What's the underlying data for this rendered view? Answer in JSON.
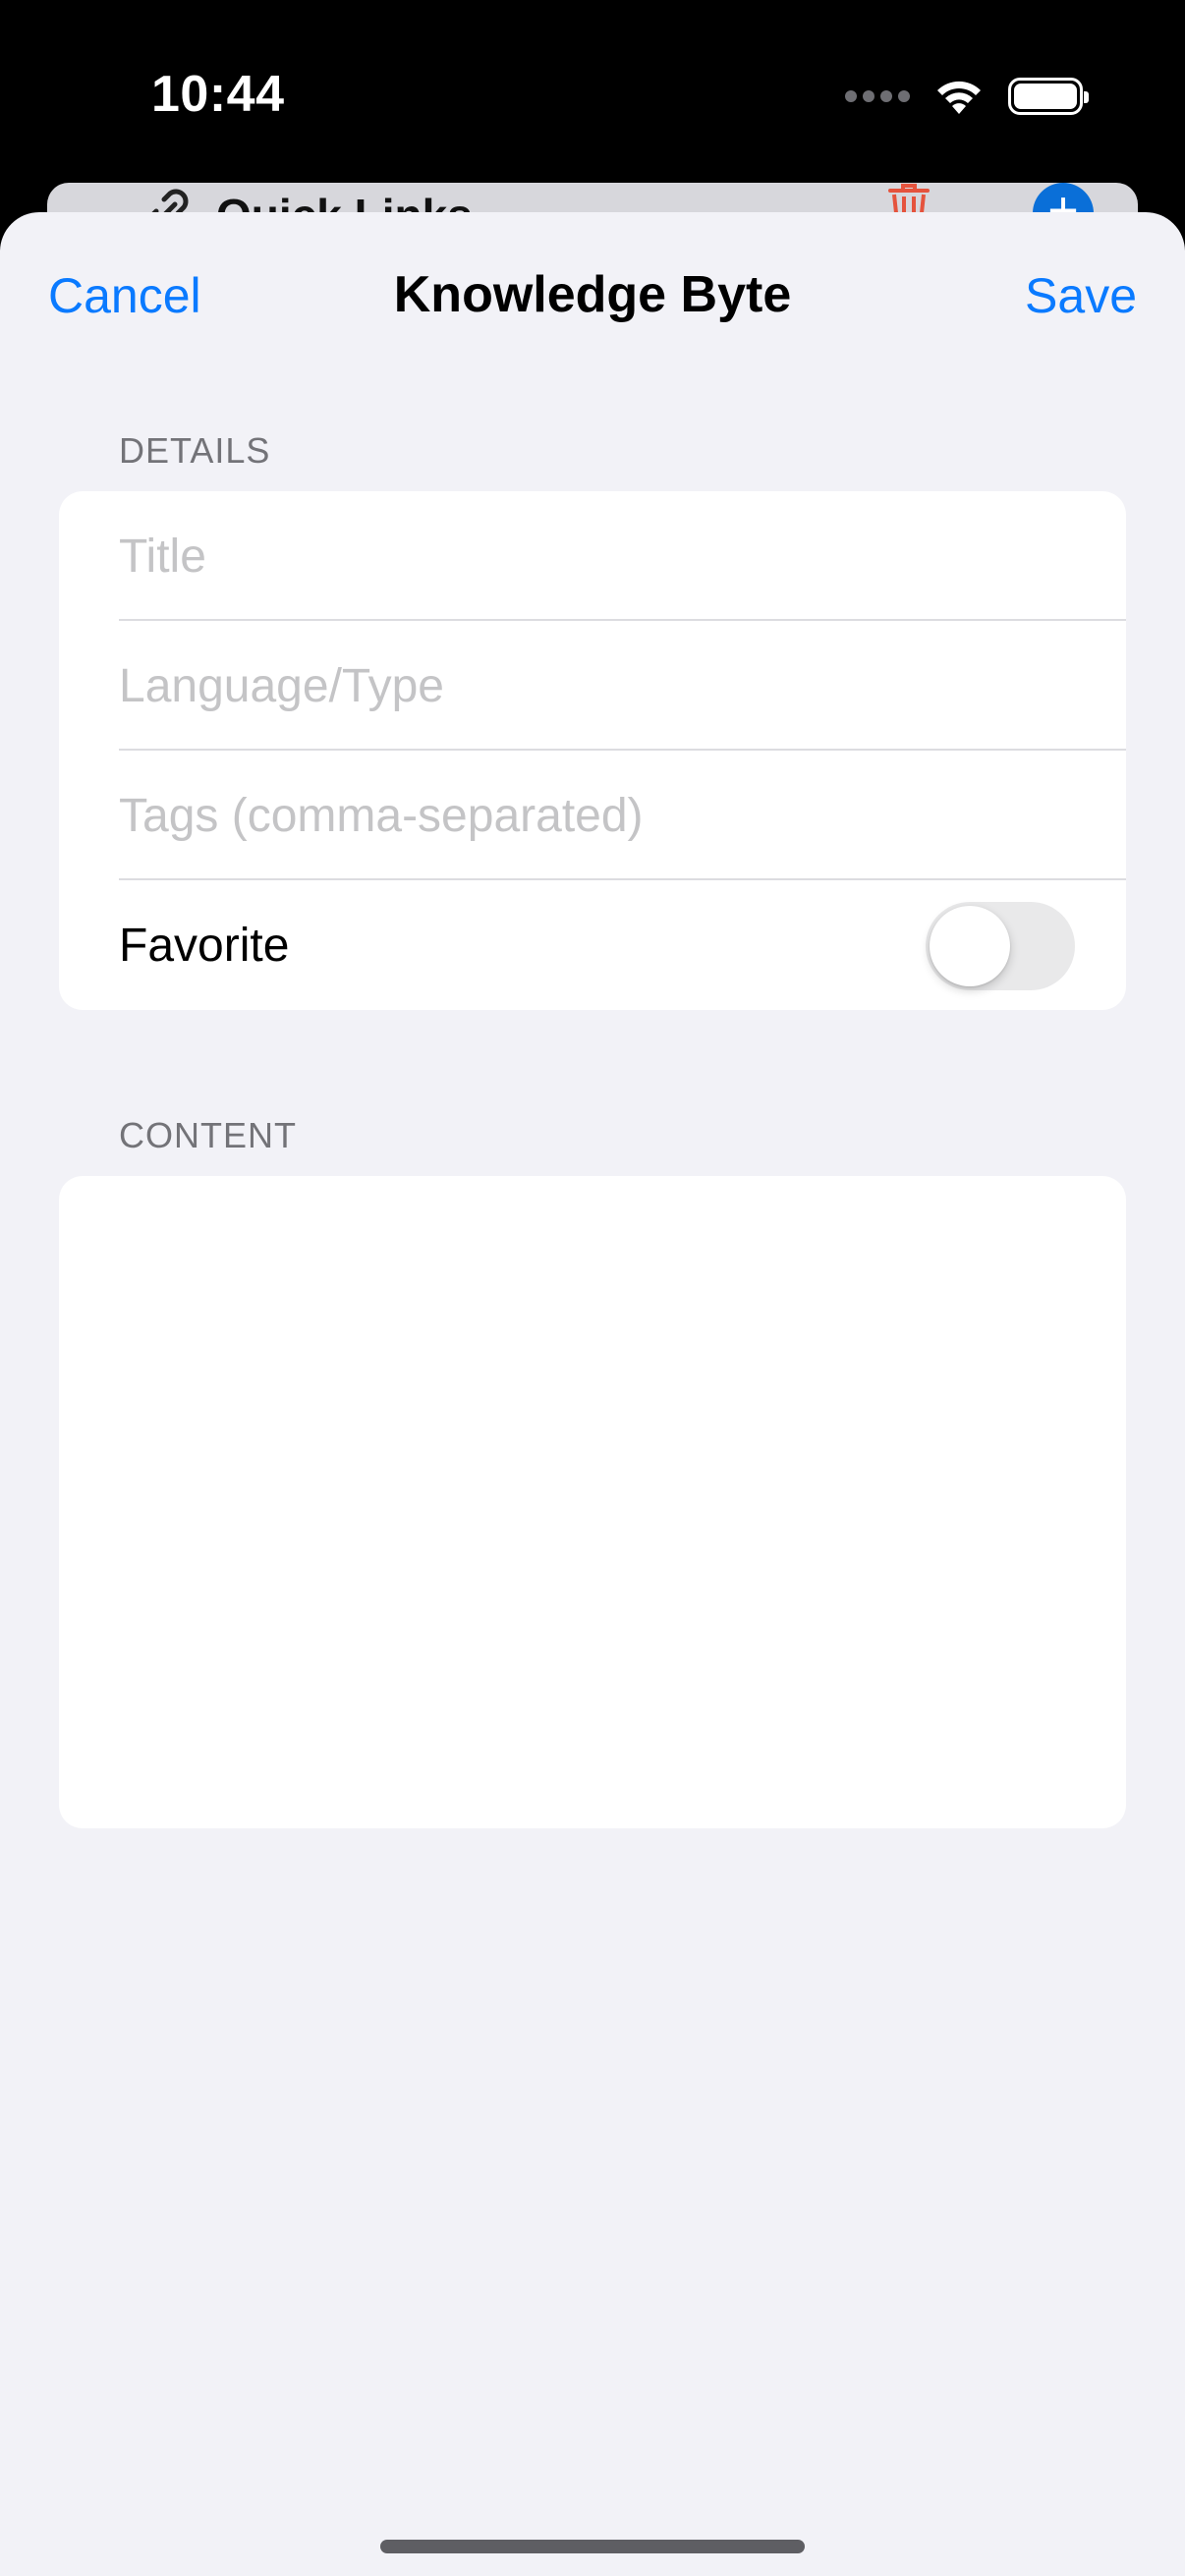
{
  "status_bar": {
    "time": "10:44"
  },
  "background": {
    "card_title": "Quick Links"
  },
  "nav": {
    "cancel_label": "Cancel",
    "title": "Knowledge Byte",
    "save_label": "Save"
  },
  "details": {
    "header": "DETAILS",
    "title_placeholder": "Title",
    "title_value": "",
    "language_placeholder": "Language/Type",
    "language_value": "",
    "tags_placeholder": "Tags (comma-separated)",
    "tags_value": "",
    "favorite_label": "Favorite",
    "favorite_on": false
  },
  "content": {
    "header": "CONTENT",
    "value": ""
  },
  "colors": {
    "accent": "#0a7aff",
    "sheet_background": "#f2f2f7",
    "destructive": "#e5533d"
  }
}
